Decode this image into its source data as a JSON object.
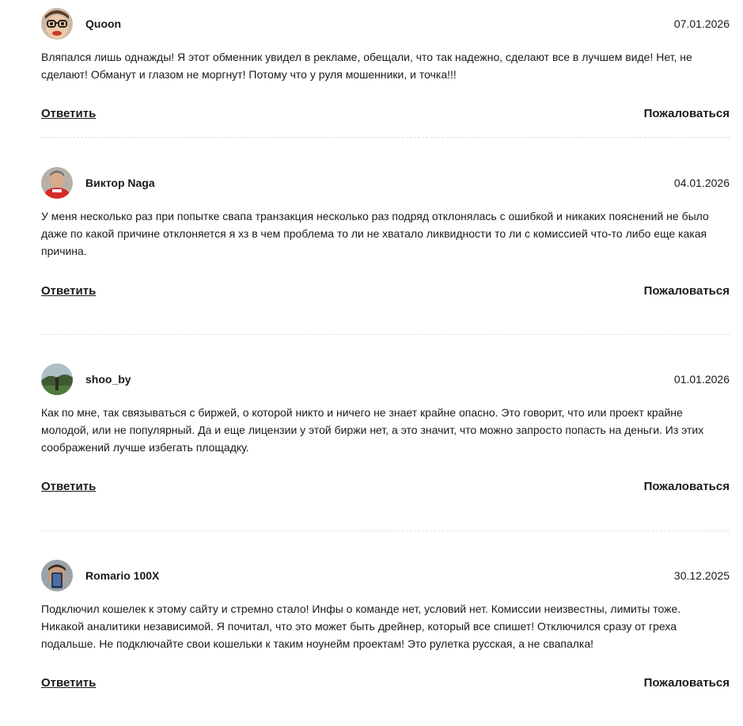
{
  "comments": [
    {
      "author": "Quoon",
      "date": "07.01.2026",
      "avatar_icon": "cartoon-face-avatar",
      "text": "Вляпался лишь однажды! Я этот обменник увидел в рекламе, обещали, что так надежно, сделают все в лучшем виде! Нет, не сделают! Обманут и глазом не моргнут! Потому что у руля мошенники, и точка!!!",
      "reply_label": "Ответить",
      "report_label": "Пожаловаться"
    },
    {
      "author": "Виктор Naga",
      "date": "04.01.2026",
      "avatar_icon": "man-red-shirt-avatar",
      "text": "У меня несколько раз при попытке свапа транзакция несколько раз подряд отклонялась с ошибкой и никаких пояснений не было даже по какой причине отклоняется я хз в чем проблема то ли не хватало ликвидности то ли с комиссией что-то либо еще какая причина.",
      "reply_label": "Ответить",
      "report_label": "Пожаловаться"
    },
    {
      "author": "shoo_by",
      "date": "01.01.2026",
      "avatar_icon": "landscape-photo-avatar",
      "text": "Как по мне, так связываться с биржей, о которой никто и ничего не знает крайне опасно. Это говорит, что или проект крайне молодой, или не популярный. Да и еще лицензии у этой биржи нет, а это значит, что можно запросто попасть на деньги. Из этих соображений лучше избегать площадку.",
      "reply_label": "Ответить",
      "report_label": "Пожаловаться"
    },
    {
      "author": "Romario 100X",
      "date": "30.12.2025",
      "avatar_icon": "selfie-phone-avatar",
      "text": "Подключил кошелек к этому сайту и стремно стало! Инфы о команде нет, условий нет. Комиссии неизвестны, лимиты тоже. Никакой аналитики независимой. Я почитал, что это может быть дрейнер, который все спишет! Отключился сразу от греха подальше. Не подключайте свои кошельки к таким ноунейм проектам! Это рулетка русская, а не свапалка!",
      "reply_label": "Ответить",
      "report_label": "Пожаловаться"
    }
  ]
}
